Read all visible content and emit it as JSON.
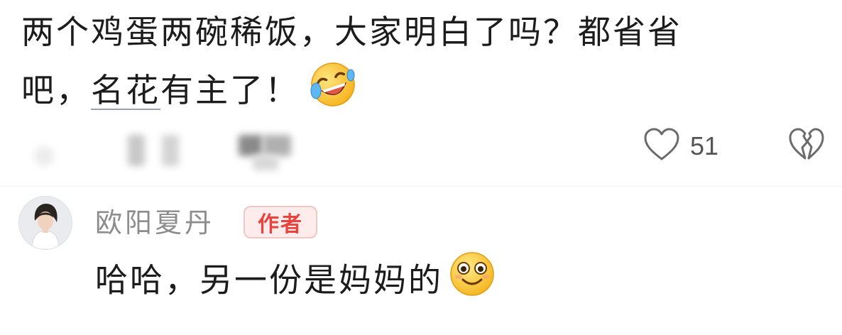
{
  "comment": {
    "line1": "两个鸡蛋两碗稀饭，大家明白了吗？都省省",
    "line2_prefix": "吧，",
    "line2_highlight": "名花",
    "line2_suffix": "有主了！",
    "emoji": "laughing-tears-emoji",
    "like_count": "51",
    "icons": {
      "like": "heart-outline-icon",
      "dislike": "broken-heart-icon"
    }
  },
  "reply": {
    "author_name": "欧阳夏丹",
    "author_tag": "作者",
    "text": "哈哈，另一份是妈妈的",
    "emoji": "smiling-face-emoji"
  },
  "colors": {
    "tag_text": "#e8443d",
    "tag_bg": "#fdeceb",
    "name_gray": "#8c8c8c",
    "icon_gray": "#6b6b6b"
  }
}
